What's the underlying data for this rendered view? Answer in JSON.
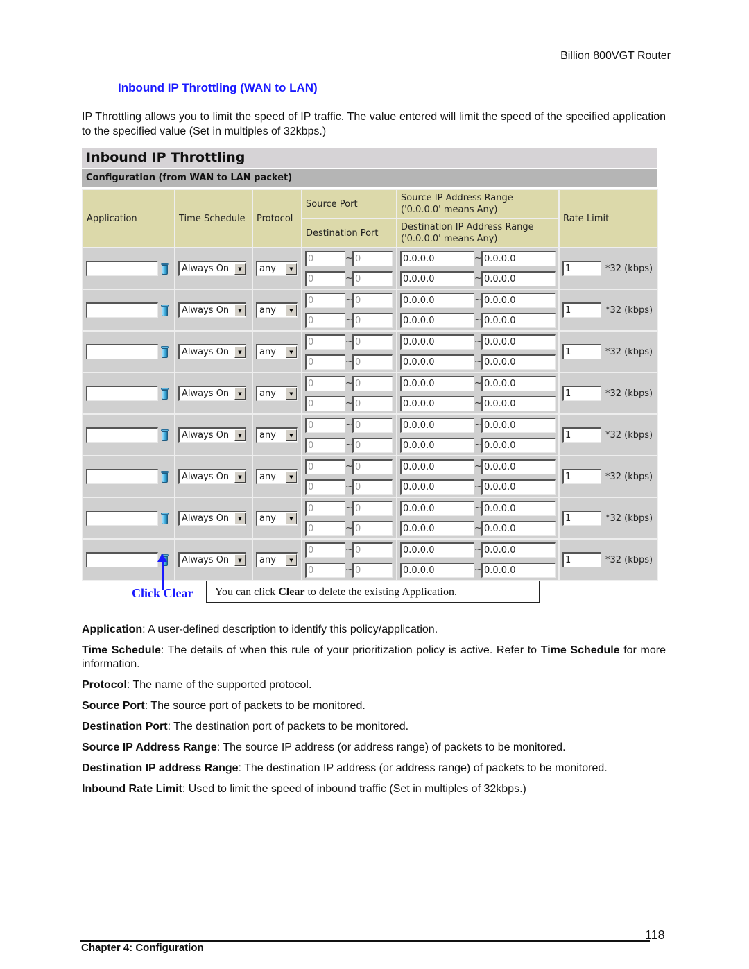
{
  "running_header": "Billion 800VGT Router",
  "section_title": "Inbound IP Throttling (WAN to LAN)",
  "intro": "IP Throttling allows you to limit the speed of IP traffic. The value entered will limit the speed of the specified application to the specified value (Set in multiples of 32kbps.)",
  "panel": {
    "title": "Inbound IP Throttling",
    "subtitle": "Configuration (from WAN to LAN packet)",
    "headers": {
      "application": "Application",
      "time_schedule": "Time Schedule",
      "protocol": "Protocol",
      "source_port": "Source Port",
      "destination_port": "Destination Port",
      "source_ip": "Source IP Address Range ('0.0.0.0' means Any)",
      "destination_ip": "Destination IP Address Range ('0.0.0.0' means Any)",
      "rate_limit": "Rate Limit"
    },
    "rate_unit": "*32 (kbps)",
    "tilde": "~",
    "rows": [
      {
        "application": "",
        "schedule": "Always On",
        "protocol": "any",
        "src_port_from": "0",
        "src_port_to": "0",
        "dst_port_from": "0",
        "dst_port_to": "0",
        "src_ip_from": "0.0.0.0",
        "src_ip_to": "0.0.0.0",
        "dst_ip_from": "0.0.0.0",
        "dst_ip_to": "0.0.0.0",
        "rate": "1"
      },
      {
        "application": "",
        "schedule": "Always On",
        "protocol": "any",
        "src_port_from": "0",
        "src_port_to": "0",
        "dst_port_from": "0",
        "dst_port_to": "0",
        "src_ip_from": "0.0.0.0",
        "src_ip_to": "0.0.0.0",
        "dst_ip_from": "0.0.0.0",
        "dst_ip_to": "0.0.0.0",
        "rate": "1"
      },
      {
        "application": "",
        "schedule": "Always On",
        "protocol": "any",
        "src_port_from": "0",
        "src_port_to": "0",
        "dst_port_from": "0",
        "dst_port_to": "0",
        "src_ip_from": "0.0.0.0",
        "src_ip_to": "0.0.0.0",
        "dst_ip_from": "0.0.0.0",
        "dst_ip_to": "0.0.0.0",
        "rate": "1"
      },
      {
        "application": "",
        "schedule": "Always On",
        "protocol": "any",
        "src_port_from": "0",
        "src_port_to": "0",
        "dst_port_from": "0",
        "dst_port_to": "0",
        "src_ip_from": "0.0.0.0",
        "src_ip_to": "0.0.0.0",
        "dst_ip_from": "0.0.0.0",
        "dst_ip_to": "0.0.0.0",
        "rate": "1"
      },
      {
        "application": "",
        "schedule": "Always On",
        "protocol": "any",
        "src_port_from": "0",
        "src_port_to": "0",
        "dst_port_from": "0",
        "dst_port_to": "0",
        "src_ip_from": "0.0.0.0",
        "src_ip_to": "0.0.0.0",
        "dst_ip_from": "0.0.0.0",
        "dst_ip_to": "0.0.0.0",
        "rate": "1"
      },
      {
        "application": "",
        "schedule": "Always On",
        "protocol": "any",
        "src_port_from": "0",
        "src_port_to": "0",
        "dst_port_from": "0",
        "dst_port_to": "0",
        "src_ip_from": "0.0.0.0",
        "src_ip_to": "0.0.0.0",
        "dst_ip_from": "0.0.0.0",
        "dst_ip_to": "0.0.0.0",
        "rate": "1"
      },
      {
        "application": "",
        "schedule": "Always On",
        "protocol": "any",
        "src_port_from": "0",
        "src_port_to": "0",
        "dst_port_from": "0",
        "dst_port_to": "0",
        "src_ip_from": "0.0.0.0",
        "src_ip_to": "0.0.0.0",
        "dst_ip_from": "0.0.0.0",
        "dst_ip_to": "0.0.0.0",
        "rate": "1"
      },
      {
        "application": "",
        "schedule": "Always On",
        "protocol": "any",
        "src_port_from": "0",
        "src_port_to": "0",
        "dst_port_from": "0",
        "dst_port_to": "0",
        "src_ip_from": "0.0.0.0",
        "src_ip_to": "0.0.0.0",
        "dst_ip_from": "0.0.0.0",
        "dst_ip_to": "0.0.0.0",
        "rate": "1"
      }
    ]
  },
  "annotation": {
    "label": "Click Clear",
    "callout_prefix": "You can click ",
    "callout_bold": "Clear",
    "callout_suffix": " to delete the existing Application."
  },
  "definitions": [
    {
      "term": "Application",
      "text": ": A user-defined description to identify this policy/application."
    },
    {
      "term": "Time Schedule",
      "text": ": The details of when this rule of your prioritization policy is active. Refer to ",
      "term2": "Time Schedule",
      "text2": " for more information."
    },
    {
      "term": "Protocol",
      "text": ": The name of the supported protocol."
    },
    {
      "term": "Source Port",
      "text": ": The source port of packets to be monitored."
    },
    {
      "term": "Destination Port",
      "text": ": The destination port of packets to be monitored."
    },
    {
      "term": "Source IP Address Range",
      "text": ": The source IP address (or address range) of packets to be monitored."
    },
    {
      "term": "Destination IP address Range",
      "text": ": The destination IP address (or address range) of packets to be monitored."
    },
    {
      "term": "Inbound Rate Limit",
      "text": ": Used to limit the speed of inbound traffic (Set in multiples of 32kbps.)"
    }
  ],
  "footer": {
    "page_number": "118",
    "chapter": "Chapter 4: Configuration"
  }
}
